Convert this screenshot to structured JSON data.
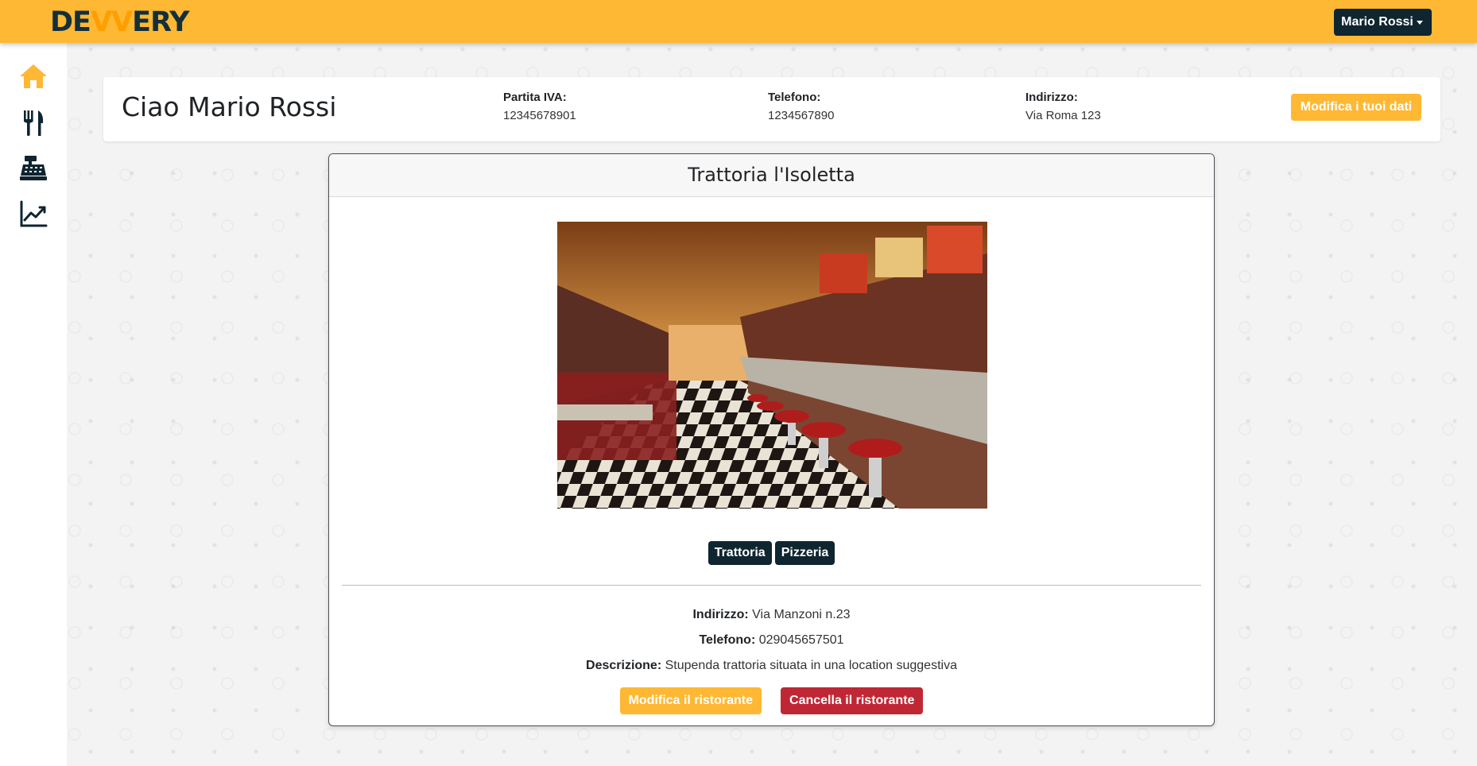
{
  "app": {
    "logo_text_left": "DE",
    "logo_text_accent": "VV",
    "logo_text_right": "ERY",
    "user_menu_label": "Mario Rossi"
  },
  "sidebar": {
    "items": [
      {
        "icon": "home-icon",
        "active": true
      },
      {
        "icon": "fork-knife-icon",
        "active": false
      },
      {
        "icon": "cash-register-icon",
        "active": false
      },
      {
        "icon": "line-chart-icon",
        "active": false
      }
    ]
  },
  "header": {
    "greeting": "Ciao Mario Rossi",
    "partita_iva_label": "Partita IVA:",
    "partita_iva_value": "12345678901",
    "telefono_label": "Telefono:",
    "telefono_value": "1234567890",
    "indirizzo_label": "Indirizzo:",
    "indirizzo_value": "Via Roma 123",
    "edit_button": "Modifica i tuoi dati"
  },
  "restaurant": {
    "name": "Trattoria l'Isoletta",
    "tags": [
      "Trattoria",
      "Pizzeria"
    ],
    "indirizzo_label": "Indirizzo:",
    "indirizzo_value": "Via Manzoni n.23",
    "telefono_label": "Telefono:",
    "telefono_value": "029045657501",
    "descrizione_label": "Descrizione:",
    "descrizione_value": "Stupenda trattoria situata in una location suggestiva",
    "edit_button": "Modifica il ristorante",
    "delete_button": "Cancella il ristorante"
  },
  "colors": {
    "brand": "#ffb833",
    "dark": "#0f2530",
    "danger": "#c02734"
  }
}
